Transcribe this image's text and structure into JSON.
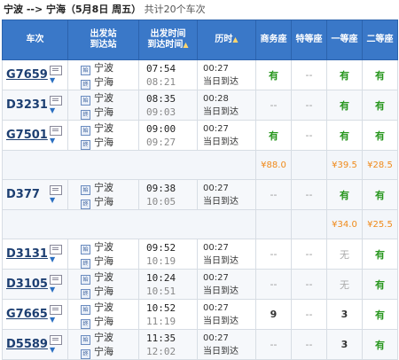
{
  "header": {
    "route": "宁波 --> 宁海（5月8日 周五）",
    "count": "共计20个车次"
  },
  "columns": {
    "train": "车次",
    "station_1": "出发站",
    "station_2": "到达站",
    "time_1": "出发时间",
    "time_2": "到达时间",
    "duration": "历时",
    "business": "商务座",
    "premium": "特等座",
    "first": "一等座",
    "second": "二等座"
  },
  "rows": [
    {
      "train": "G7659",
      "link": true,
      "from": "宁波",
      "to": "宁海",
      "dep": "07:54",
      "arr": "08:21",
      "dur": "00:27",
      "day": "当日到达",
      "business": "有",
      "premium": "--",
      "first": "有",
      "second": "有"
    },
    {
      "train": "D3231",
      "link": false,
      "from": "宁波",
      "to": "宁海",
      "dep": "08:35",
      "arr": "09:03",
      "dur": "00:28",
      "day": "当日到达",
      "business": "--",
      "premium": "--",
      "first": "有",
      "second": "有"
    },
    {
      "train": "G7501",
      "link": true,
      "from": "宁波",
      "to": "宁海",
      "dep": "09:00",
      "arr": "09:27",
      "dur": "00:27",
      "day": "当日到达",
      "business": "有",
      "premium": "--",
      "first": "有",
      "second": "有",
      "prices": {
        "business": "¥88.0",
        "premium": "",
        "first": "¥39.5",
        "second": "¥28.5"
      }
    },
    {
      "train": "D377",
      "link": false,
      "from": "宁波",
      "to": "宁海",
      "dep": "09:38",
      "arr": "10:05",
      "dur": "00:27",
      "day": "当日到达",
      "business": "--",
      "premium": "--",
      "first": "有",
      "second": "有",
      "prices": {
        "business": "",
        "premium": "",
        "first": "¥34.0",
        "second": "¥25.5"
      }
    },
    {
      "train": "D3131",
      "link": true,
      "from": "宁波",
      "to": "宁海",
      "dep": "09:52",
      "arr": "10:19",
      "dur": "00:27",
      "day": "当日到达",
      "business": "--",
      "premium": "--",
      "first": "无",
      "second": "有"
    },
    {
      "train": "D3105",
      "link": true,
      "from": "宁波",
      "to": "宁海",
      "dep": "10:24",
      "arr": "10:51",
      "dur": "00:27",
      "day": "当日到达",
      "business": "--",
      "premium": "--",
      "first": "无",
      "second": "有"
    },
    {
      "train": "G7665",
      "link": true,
      "from": "宁波",
      "to": "宁海",
      "dep": "10:52",
      "arr": "11:19",
      "dur": "00:27",
      "day": "当日到达",
      "business": "9",
      "premium": "--",
      "first": "3",
      "second": "有"
    },
    {
      "train": "D5589",
      "link": true,
      "from": "宁波",
      "to": "宁海",
      "dep": "11:35",
      "arr": "12:02",
      "dur": "00:27",
      "day": "当日到达",
      "business": "--",
      "premium": "--",
      "first": "3",
      "second": "有"
    }
  ]
}
